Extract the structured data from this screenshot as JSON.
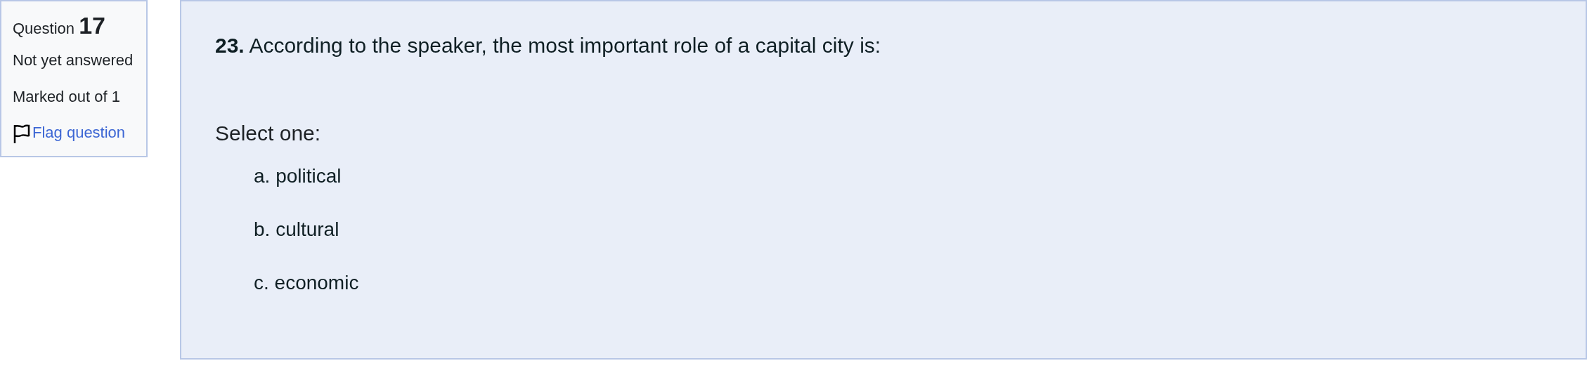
{
  "info": {
    "question_label": "Question",
    "question_number": "17",
    "state": "Not yet answered",
    "grade": "Marked out of 1",
    "flag_link": "Flag question"
  },
  "question": {
    "text": "**23.** According to the speaker, the most important role of a capital city is:",
    "prompt": "Select one:",
    "options": [
      {
        "label": "a. political"
      },
      {
        "label": "b. cultural"
      },
      {
        "label": "c. economic"
      }
    ]
  }
}
